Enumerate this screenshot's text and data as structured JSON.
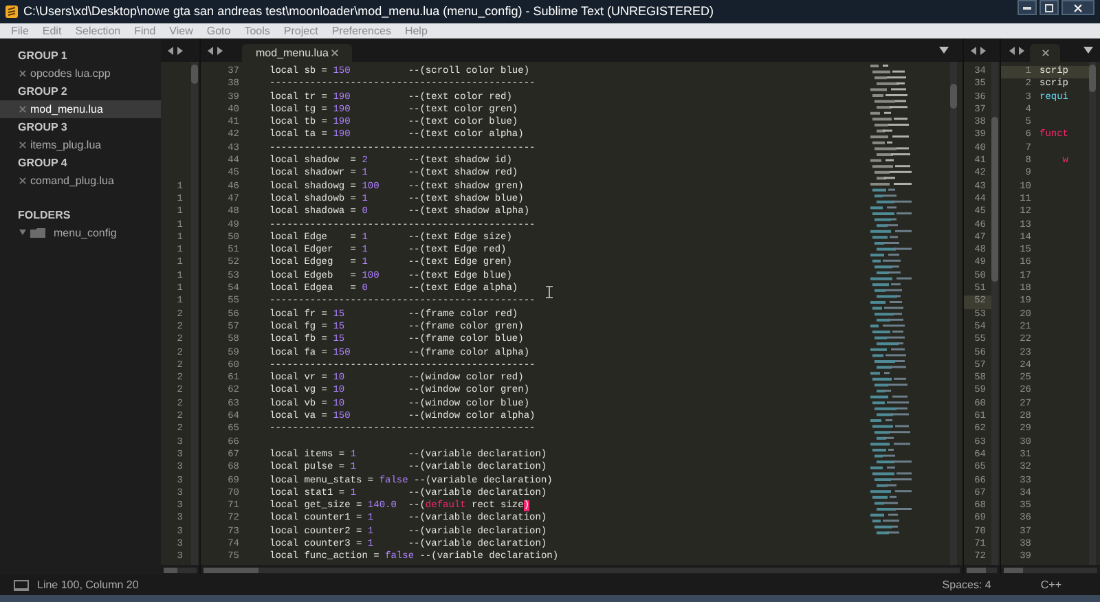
{
  "window": {
    "title": "C:\\Users\\xd\\Desktop\\nowe gta san andreas test\\moonloader\\mod_menu.lua (menu_config) - Sublime Text (UNREGISTERED)"
  },
  "menu": [
    "File",
    "Edit",
    "Selection",
    "Find",
    "View",
    "Goto",
    "Tools",
    "Project",
    "Preferences",
    "Help"
  ],
  "sidebar": {
    "groups": [
      {
        "label": "GROUP 1",
        "files": [
          {
            "name": "opcodes lua.cpp",
            "selected": false
          }
        ]
      },
      {
        "label": "GROUP 2",
        "files": [
          {
            "name": "mod_menu.lua",
            "selected": true
          }
        ]
      },
      {
        "label": "GROUP 3",
        "files": [
          {
            "name": "items_plug.lua",
            "selected": false
          }
        ]
      },
      {
        "label": "GROUP 4",
        "files": [
          {
            "name": "comand_plug.lua",
            "selected": false
          }
        ]
      }
    ],
    "folders_label": "FOLDERS",
    "folders": [
      {
        "name": "menu_config",
        "expanded": true
      }
    ]
  },
  "editor": {
    "tab": {
      "label": "mod_menu.lua",
      "selected": true
    },
    "lines": [
      {
        "number": "37",
        "code": [
          {
            "text": "local sb = ",
            "kind": "plain"
          },
          {
            "text": "150",
            "kind": "number"
          }
        ],
        "comment": [
          {
            "text": "--(scroll color blue)",
            "kind": "comment"
          }
        ]
      },
      {
        "number": "38",
        "kind": "rule",
        "text": "----------------------------------------------"
      },
      {
        "number": "39",
        "code": [
          {
            "text": "local tr = ",
            "kind": "plain"
          },
          {
            "text": "190",
            "kind": "number"
          }
        ],
        "comment": [
          {
            "text": "--(text color red)",
            "kind": "comment"
          }
        ]
      },
      {
        "number": "40",
        "code": [
          {
            "text": "local tg = ",
            "kind": "plain"
          },
          {
            "text": "190",
            "kind": "number"
          }
        ],
        "comment": [
          {
            "text": "--(text color gren)",
            "kind": "comment"
          }
        ]
      },
      {
        "number": "41",
        "code": [
          {
            "text": "local tb = ",
            "kind": "plain"
          },
          {
            "text": "190",
            "kind": "number"
          }
        ],
        "comment": [
          {
            "text": "--(text color blue)",
            "kind": "comment"
          }
        ]
      },
      {
        "number": "42",
        "code": [
          {
            "text": "local ta = ",
            "kind": "plain"
          },
          {
            "text": "190",
            "kind": "number"
          }
        ],
        "comment": [
          {
            "text": "--(text color alpha)",
            "kind": "comment"
          }
        ]
      },
      {
        "number": "43",
        "kind": "rule",
        "text": "----------------------------------------------"
      },
      {
        "number": "44",
        "code": [
          {
            "text": "local shadow  = ",
            "kind": "plain"
          },
          {
            "text": "2",
            "kind": "number"
          }
        ],
        "comment": [
          {
            "text": "--(text shadow id)",
            "kind": "comment"
          }
        ]
      },
      {
        "number": "45",
        "code": [
          {
            "text": "local shadowr = ",
            "kind": "plain"
          },
          {
            "text": "1",
            "kind": "number"
          }
        ],
        "comment": [
          {
            "text": "--(text shadow red)",
            "kind": "comment"
          }
        ]
      },
      {
        "number": "46",
        "marker": "1",
        "code": [
          {
            "text": "local shadowg = ",
            "kind": "plain"
          },
          {
            "text": "100",
            "kind": "number"
          }
        ],
        "comment": [
          {
            "text": "--(text shadow gren)",
            "kind": "comment"
          }
        ]
      },
      {
        "number": "47",
        "marker": "1",
        "code": [
          {
            "text": "local shadowb = ",
            "kind": "plain"
          },
          {
            "text": "1",
            "kind": "number"
          }
        ],
        "comment": [
          {
            "text": "--(text shadow blue)",
            "kind": "comment"
          }
        ]
      },
      {
        "number": "48",
        "marker": "1",
        "code": [
          {
            "text": "local shadowa = ",
            "kind": "plain"
          },
          {
            "text": "0",
            "kind": "number"
          }
        ],
        "comment": [
          {
            "text": "--(text shadow alpha)",
            "kind": "comment"
          }
        ]
      },
      {
        "number": "49",
        "marker": "1",
        "kind": "rule",
        "text": "----------------------------------------------"
      },
      {
        "number": "50",
        "marker": "1",
        "code": [
          {
            "text": "local Edge    = ",
            "kind": "plain"
          },
          {
            "text": "1",
            "kind": "number"
          }
        ],
        "comment": [
          {
            "text": "--(text Edge size)",
            "kind": "comment"
          }
        ]
      },
      {
        "number": "51",
        "marker": "1",
        "code": [
          {
            "text": "local Edger   = ",
            "kind": "plain"
          },
          {
            "text": "1",
            "kind": "number"
          }
        ],
        "comment": [
          {
            "text": "--(text Edge red)",
            "kind": "comment"
          }
        ]
      },
      {
        "number": "52",
        "marker": "1",
        "code": [
          {
            "text": "local Edgeg   = ",
            "kind": "plain"
          },
          {
            "text": "1",
            "kind": "number"
          }
        ],
        "comment": [
          {
            "text": "--(text Edge gren)",
            "kind": "comment"
          }
        ]
      },
      {
        "number": "53",
        "marker": "1",
        "code": [
          {
            "text": "local Edgeb   = ",
            "kind": "plain"
          },
          {
            "text": "100",
            "kind": "number"
          }
        ],
        "comment": [
          {
            "text": "--(text Edge blue)",
            "kind": "comment"
          }
        ]
      },
      {
        "number": "54",
        "marker": "1",
        "code": [
          {
            "text": "local Edgea   = ",
            "kind": "plain"
          },
          {
            "text": "0",
            "kind": "number"
          }
        ],
        "comment": [
          {
            "text": "--(text Edge alpha)",
            "kind": "comment"
          }
        ]
      },
      {
        "number": "55",
        "marker": "1",
        "kind": "rule",
        "text": "----------------------------------------------"
      },
      {
        "number": "56",
        "marker": "2",
        "code": [
          {
            "text": "local fr = ",
            "kind": "plain"
          },
          {
            "text": "15",
            "kind": "number"
          }
        ],
        "comment": [
          {
            "text": "--(frame color red)",
            "kind": "comment"
          }
        ]
      },
      {
        "number": "57",
        "marker": "2",
        "code": [
          {
            "text": "local fg = ",
            "kind": "plain"
          },
          {
            "text": "15",
            "kind": "number"
          }
        ],
        "comment": [
          {
            "text": "--(frame color gren)",
            "kind": "comment"
          }
        ]
      },
      {
        "number": "58",
        "marker": "2",
        "code": [
          {
            "text": "local fb = ",
            "kind": "plain"
          },
          {
            "text": "15",
            "kind": "number"
          }
        ],
        "comment": [
          {
            "text": "--(frame color blue)",
            "kind": "comment"
          }
        ]
      },
      {
        "number": "59",
        "marker": "2",
        "code": [
          {
            "text": "local fa = ",
            "kind": "plain"
          },
          {
            "text": "150",
            "kind": "number"
          }
        ],
        "comment": [
          {
            "text": "--(frame color alpha)",
            "kind": "comment"
          }
        ]
      },
      {
        "number": "60",
        "marker": "2",
        "kind": "rule",
        "text": "----------------------------------------------"
      },
      {
        "number": "61",
        "marker": "2",
        "code": [
          {
            "text": "local vr = ",
            "kind": "plain"
          },
          {
            "text": "10",
            "kind": "number"
          }
        ],
        "comment": [
          {
            "text": "--(window color red)",
            "kind": "comment"
          }
        ]
      },
      {
        "number": "62",
        "marker": "2",
        "code": [
          {
            "text": "local vg = ",
            "kind": "plain"
          },
          {
            "text": "10",
            "kind": "number"
          }
        ],
        "comment": [
          {
            "text": "--(window color gren)",
            "kind": "comment"
          }
        ]
      },
      {
        "number": "63",
        "marker": "2",
        "code": [
          {
            "text": "local vb = ",
            "kind": "plain"
          },
          {
            "text": "10",
            "kind": "number"
          }
        ],
        "comment": [
          {
            "text": "--(window color blue)",
            "kind": "comment"
          }
        ]
      },
      {
        "number": "64",
        "marker": "2",
        "code": [
          {
            "text": "local va = ",
            "kind": "plain"
          },
          {
            "text": "150",
            "kind": "number"
          }
        ],
        "comment": [
          {
            "text": "--(window color alpha)",
            "kind": "comment"
          }
        ]
      },
      {
        "number": "65",
        "marker": "2",
        "kind": "rule",
        "text": "----------------------------------------------"
      },
      {
        "number": "66",
        "marker": "3",
        "kind": "blank"
      },
      {
        "number": "67",
        "marker": "3",
        "code": [
          {
            "text": "local items = ",
            "kind": "plain"
          },
          {
            "text": "1",
            "kind": "number"
          }
        ],
        "comment": [
          {
            "text": "--(variable declaration)",
            "kind": "comment"
          }
        ]
      },
      {
        "number": "68",
        "marker": "3",
        "code": [
          {
            "text": "local pulse = ",
            "kind": "plain"
          },
          {
            "text": "1",
            "kind": "number"
          }
        ],
        "comment": [
          {
            "text": "--(variable declaration)",
            "kind": "comment"
          }
        ]
      },
      {
        "number": "69",
        "marker": "3",
        "code": [
          {
            "text": "local menu_stats = ",
            "kind": "plain"
          },
          {
            "text": "false",
            "kind": "number"
          }
        ],
        "comment": [
          {
            "text": "--(variable declaration)",
            "kind": "comment"
          }
        ]
      },
      {
        "number": "70",
        "marker": "3",
        "code": [
          {
            "text": "local stat1 = ",
            "kind": "plain"
          },
          {
            "text": "1",
            "kind": "number"
          }
        ],
        "comment": [
          {
            "text": "--(variable declaration)",
            "kind": "comment"
          }
        ]
      },
      {
        "number": "71",
        "marker": "3",
        "code": [
          {
            "text": "local get_size = ",
            "kind": "plain"
          },
          {
            "text": "140.0",
            "kind": "number"
          }
        ],
        "comment": [
          {
            "text": "--(",
            "kind": "comment"
          },
          {
            "text": "default",
            "kind": "keyword"
          },
          {
            "text": " rect size",
            "kind": "comment"
          },
          {
            "text": ")",
            "kind": "match"
          }
        ]
      },
      {
        "number": "72",
        "marker": "3",
        "code": [
          {
            "text": "local counter1 = ",
            "kind": "plain"
          },
          {
            "text": "1",
            "kind": "number"
          }
        ],
        "comment": [
          {
            "text": "--(variable declaration)",
            "kind": "comment"
          }
        ]
      },
      {
        "number": "73",
        "marker": "3",
        "code": [
          {
            "text": "local counter2 = ",
            "kind": "plain"
          },
          {
            "text": "1",
            "kind": "number"
          }
        ],
        "comment": [
          {
            "text": "--(variable declaration)",
            "kind": "comment"
          }
        ]
      },
      {
        "number": "74",
        "marker": "3",
        "code": [
          {
            "text": "local counter3 = ",
            "kind": "plain"
          },
          {
            "text": "1",
            "kind": "number"
          }
        ],
        "comment": [
          {
            "text": "--(variable declaration)",
            "kind": "comment"
          }
        ]
      },
      {
        "number": "75",
        "marker": "3",
        "code": [
          {
            "text": "local func_action = ",
            "kind": "plain"
          },
          {
            "text": "false",
            "kind": "number"
          }
        ],
        "comment": [
          {
            "text": "--(variable declaration)",
            "kind": "comment"
          }
        ]
      }
    ]
  },
  "pane_3": {
    "lines": [
      {
        "number": "34",
        "current": false
      },
      {
        "number": "35",
        "current": false
      },
      {
        "number": "36",
        "current": false
      },
      {
        "number": "37",
        "current": false
      },
      {
        "number": "38",
        "current": false
      },
      {
        "number": "39",
        "current": false
      },
      {
        "number": "40",
        "current": false
      },
      {
        "number": "41",
        "current": false
      },
      {
        "number": "42",
        "current": false
      },
      {
        "number": "43",
        "current": false
      },
      {
        "number": "44",
        "current": false
      },
      {
        "number": "45",
        "current": false
      },
      {
        "number": "46",
        "current": false
      },
      {
        "number": "47",
        "current": false
      },
      {
        "number": "48",
        "current": false
      },
      {
        "number": "49",
        "current": false
      },
      {
        "number": "50",
        "current": false
      },
      {
        "number": "51",
        "current": false
      },
      {
        "number": "52",
        "current": true
      },
      {
        "number": "53",
        "current": false
      },
      {
        "number": "54",
        "current": false
      },
      {
        "number": "55",
        "current": false
      },
      {
        "number": "56",
        "current": false
      },
      {
        "number": "57",
        "current": false
      },
      {
        "number": "58",
        "current": false
      },
      {
        "number": "59",
        "current": false
      },
      {
        "number": "60",
        "current": false
      },
      {
        "number": "61",
        "current": false
      },
      {
        "number": "62",
        "current": false
      },
      {
        "number": "63",
        "current": false
      },
      {
        "number": "64",
        "current": false
      },
      {
        "number": "65",
        "current": false
      },
      {
        "number": "66",
        "current": false
      },
      {
        "number": "67",
        "current": false
      },
      {
        "number": "68",
        "current": false
      },
      {
        "number": "69",
        "current": false
      },
      {
        "number": "70",
        "current": false
      },
      {
        "number": "71",
        "current": false
      },
      {
        "number": "72",
        "current": false
      }
    ]
  },
  "pane_4": {
    "lines": [
      {
        "number": "1",
        "current": true,
        "code": "scrip",
        "kind": "plain"
      },
      {
        "number": "2",
        "current": false,
        "code": "scrip",
        "kind": "plain"
      },
      {
        "number": "3",
        "current": false,
        "code": "requi",
        "kind": "support"
      },
      {
        "number": "4",
        "current": false
      },
      {
        "number": "5",
        "current": false
      },
      {
        "number": "6",
        "current": false,
        "code": "funct",
        "kind": "storage"
      },
      {
        "number": "7",
        "current": false
      },
      {
        "number": "8",
        "current": false,
        "code": "    w",
        "kind": "storage"
      },
      {
        "number": "9",
        "current": false
      },
      {
        "number": "10",
        "current": false
      },
      {
        "number": "11",
        "current": false
      },
      {
        "number": "12",
        "current": false
      },
      {
        "number": "13",
        "current": false
      },
      {
        "number": "14",
        "current": false
      },
      {
        "number": "15",
        "current": false
      },
      {
        "number": "16",
        "current": false
      },
      {
        "number": "17",
        "current": false
      },
      {
        "number": "18",
        "current": false
      },
      {
        "number": "19",
        "current": false
      },
      {
        "number": "20",
        "current": false
      },
      {
        "number": "21",
        "current": false
      },
      {
        "number": "22",
        "current": false
      },
      {
        "number": "23",
        "current": false
      },
      {
        "number": "24",
        "current": false
      },
      {
        "number": "25",
        "current": false
      },
      {
        "number": "26",
        "current": false
      },
      {
        "number": "27",
        "current": false
      },
      {
        "number": "28",
        "current": false
      },
      {
        "number": "29",
        "current": false
      },
      {
        "number": "30",
        "current": false
      },
      {
        "number": "31",
        "current": false
      },
      {
        "number": "32",
        "current": false
      },
      {
        "number": "33",
        "current": false
      },
      {
        "number": "34",
        "current": false
      },
      {
        "number": "35",
        "current": false
      },
      {
        "number": "36",
        "current": false
      },
      {
        "number": "37",
        "current": false
      },
      {
        "number": "38",
        "current": false
      },
      {
        "number": "39",
        "current": false
      }
    ]
  },
  "status_bar": {
    "position": "Line 100, Column 20",
    "indentation": "Spaces: 4",
    "syntax": "C++"
  }
}
